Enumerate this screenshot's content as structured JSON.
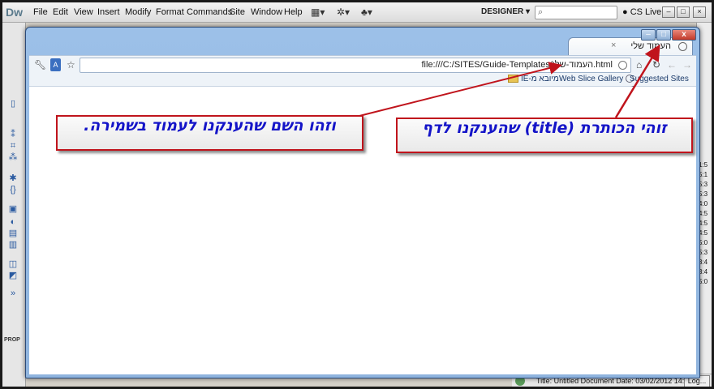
{
  "dw": {
    "logo": "Dw",
    "menus": [
      "File",
      "Edit",
      "View",
      "Insert",
      "Modify",
      "Format",
      "Commands",
      "Site",
      "Window",
      "Help"
    ],
    "workspace": "DESIGNER",
    "search_placeholder": "",
    "cs_live": "CS Live",
    "properties_label": "PROP",
    "status_title": "Title: Untitled Document  Date: 03/02/2012 14:",
    "log_button": "Log...",
    "right_numbers": [
      "1:5",
      "5:1",
      "5:3",
      "5:3",
      "4:0",
      "4:5",
      "4:5",
      "4:5",
      "5:0",
      "5:3",
      "3:4",
      "3:4",
      "5:0"
    ]
  },
  "browser": {
    "tab_title": "העמוד שלי",
    "tab_close": "×",
    "url": "file:///C:/SITES/Guide-Templates/העמוד-שלי.html",
    "bookmarks": {
      "suggested": "Suggested Sites",
      "webslice": "Web Slice Gallery",
      "imported": "מיובא מ-IE"
    },
    "win_minimize": "–",
    "win_maximize": "□",
    "win_close": "x"
  },
  "callouts": {
    "title_callout": "זוהי הכותרת (title) שהענקנו לדף",
    "name_callout": "וזהו השם שהענקנו לעמוד בשמירה."
  },
  "colors": {
    "callout_border": "#c0141c",
    "callout_text": "#1414c8",
    "arrow": "#c0141c"
  }
}
